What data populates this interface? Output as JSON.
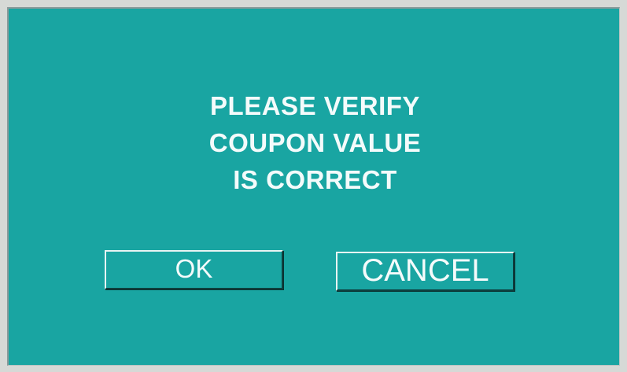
{
  "dialog": {
    "message_lines": [
      "PLEASE VERIFY",
      "COUPON VALUE",
      "IS CORRECT"
    ],
    "ok_label": "OK",
    "cancel_label": "CANCEL"
  },
  "colors": {
    "background": "#19a5a2",
    "text": "#f4fbfb",
    "frame": "#d6d9d6"
  }
}
